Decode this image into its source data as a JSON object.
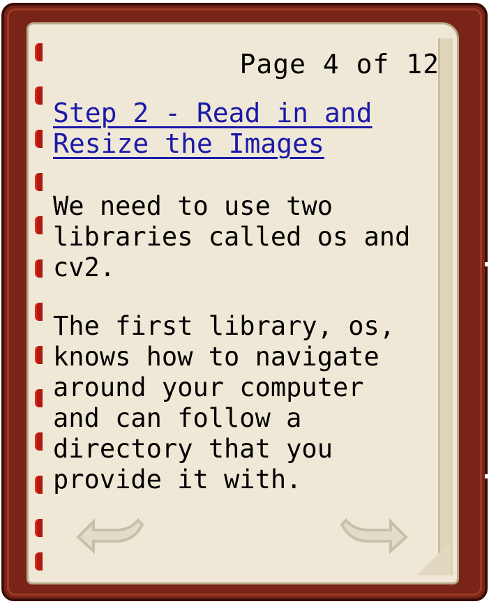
{
  "book": {
    "page_indicator": "Page 4 of 12",
    "heading_line1": "Step 2 - Read in and",
    "heading_line2": "Resize the Images",
    "paragraph1": [
      "We need to use two",
      "libraries called os and",
      "cv2."
    ],
    "paragraph2": [
      "The first library, os,",
      "knows how to navigate",
      "around your computer",
      "and can follow a",
      "directory that you",
      "provide it with."
    ],
    "prev_icon": "page-back-arrow",
    "next_icon": "page-forward-arrow"
  },
  "colors": {
    "cover": "#7a2418",
    "page": "#f0e8d6",
    "link": "#1c1aa8",
    "stitch": "#b01a10"
  }
}
